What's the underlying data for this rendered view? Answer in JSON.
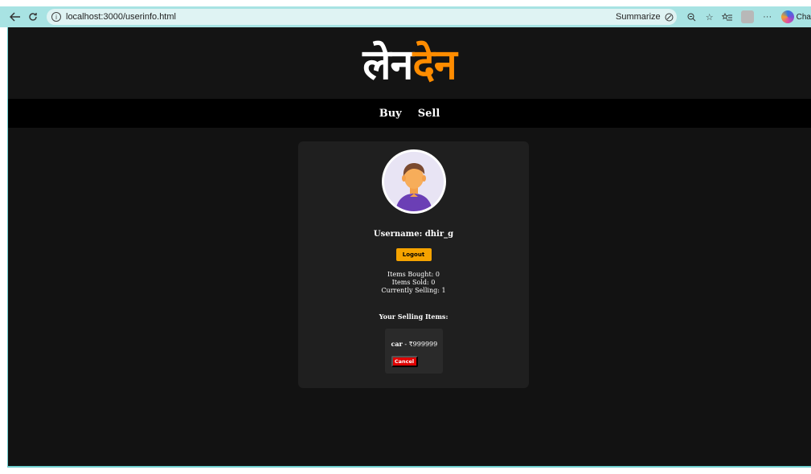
{
  "browser": {
    "url": "localhost:3000/userinfo.html",
    "summarize_label": "Summarize",
    "copilot_label": "Cha",
    "more_label": "···"
  },
  "site": {
    "logo_part1": "लेन",
    "logo_part2": "देन",
    "nav": [
      "Buy",
      "Sell"
    ]
  },
  "profile": {
    "username_text": "Username: dhir_g",
    "logout_label": "Logout",
    "stats": [
      "Items Bought: 0",
      "Items Sold: 0",
      "Currently Selling: 1"
    ],
    "selling_title": "Your Selling Items:",
    "items": [
      {
        "name": "car",
        "price": "₹999999",
        "cancel_label": "Cancel"
      }
    ]
  },
  "colors": {
    "browser_bar": "#a8e3e3",
    "accent_orange": "#ff8c00",
    "logout_button": "#f5a300",
    "cancel_button": "#e00000",
    "page_bg": "#121212",
    "card_bg": "#1f1f1f"
  }
}
